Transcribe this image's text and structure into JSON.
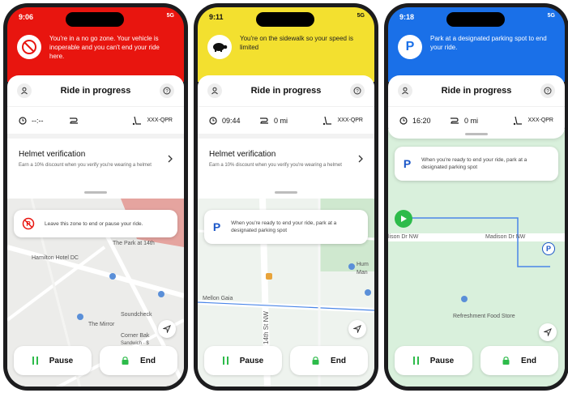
{
  "colors": {
    "no_go_red": "#e8150f",
    "sidewalk_yellow": "#f3e02f",
    "parking_blue": "#1a70e8",
    "accent_green": "#2dbb4a",
    "parking_icon_blue": "#1a56c8"
  },
  "phones": [
    {
      "status": {
        "time": "9:06",
        "signal": "5G"
      },
      "banner": {
        "icon": "no-entry-icon",
        "text": "You're in a no go zone. Your vehicle is inoperable and you can't end your ride here."
      },
      "header": {
        "title": "Ride in progress"
      },
      "stats": {
        "time": "--:--",
        "distance": "",
        "vehicle_id": "XXX-QPR"
      },
      "helmet": {
        "title": "Helmet verification",
        "subtitle": "Earn a 10% discount when you verify you're wearing a helmet"
      },
      "info": {
        "icon": "no-parking-icon",
        "text": "Leave this zone to end or pause your ride."
      },
      "map_labels": [
        "The Park at 14th",
        "Hamilton Hotel DC",
        "Soundcheck",
        "The Mirror",
        "Corner Bak",
        "Sandwich · $"
      ],
      "buttons": {
        "pause": "Pause",
        "end": "End"
      }
    },
    {
      "status": {
        "time": "9:11",
        "signal": "5G"
      },
      "banner": {
        "icon": "turtle-icon",
        "text": "You're on the sidewalk so your speed is limited"
      },
      "header": {
        "title": "Ride in progress"
      },
      "stats": {
        "time": "09:44",
        "distance": "0 mi",
        "vehicle_id": "XXX-QPR"
      },
      "helmet": {
        "title": "Helmet verification",
        "subtitle": "Earn a 10% discount when you verify you're wearing a helmet"
      },
      "info": {
        "icon": "P",
        "text": "When you're ready to end your ride, park at a designated parking spot"
      },
      "map_labels": [
        "Hum",
        "Man",
        "Mellon Gaia",
        "14th St NW"
      ],
      "buttons": {
        "pause": "Pause",
        "end": "End"
      }
    },
    {
      "status": {
        "time": "9:18",
        "signal": "5G"
      },
      "banner": {
        "icon": "P",
        "text": "Park at a designated parking spot to end your ride."
      },
      "header": {
        "title": "Ride in progress"
      },
      "stats": {
        "time": "16:20",
        "distance": "0 mi",
        "vehicle_id": "XXX-QPR"
      },
      "info": {
        "icon": "P",
        "text": "When you're ready to end your ride, park at a designated parking spot"
      },
      "map_labels": [
        "lison Dr NW",
        "Madison Dr NW",
        "Refreshment Food Store"
      ],
      "buttons": {
        "pause": "Pause",
        "end": "End"
      }
    }
  ]
}
